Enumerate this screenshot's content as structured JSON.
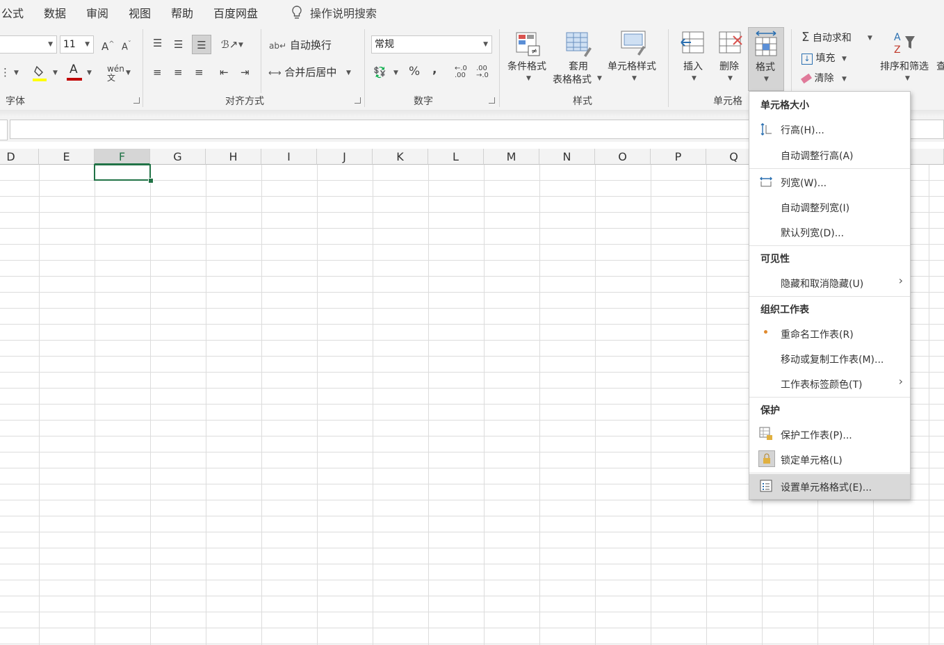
{
  "menu": {
    "tabs": [
      "公式",
      "数据",
      "审阅",
      "视图",
      "帮助",
      "百度网盘"
    ],
    "tellme": "操作说明搜索"
  },
  "ribbon": {
    "font": {
      "size": "11",
      "label": "字体"
    },
    "alignment": {
      "wrap_text": "自动换行",
      "merge_center": "合并后居中",
      "label": "对齐方式"
    },
    "number": {
      "format": "常规",
      "percent": "%",
      "comma": ",",
      "label": "数字"
    },
    "styles": {
      "conditional": "条件格式",
      "table_format_1": "套用",
      "table_format_2": "表格格式",
      "cell_styles": "单元格样式",
      "label": "样式"
    },
    "cells": {
      "insert": "插入",
      "delete": "删除",
      "format": "格式",
      "label": "单元格"
    },
    "editing": {
      "autosum": "自动求和",
      "fill": "填充",
      "clear": "清除",
      "sort_filter": "排序和筛选",
      "find": "查"
    }
  },
  "grid": {
    "columns": [
      "D",
      "E",
      "F",
      "G",
      "H",
      "I",
      "J",
      "K",
      "L",
      "M",
      "N",
      "O",
      "P",
      "Q"
    ],
    "selected_column": "F"
  },
  "dropdown": {
    "cell_size": "单元格大小",
    "row_height": "行高(H)...",
    "autofit_row": "自动调整行高(A)",
    "col_width": "列宽(W)...",
    "autofit_col": "自动调整列宽(I)",
    "default_width": "默认列宽(D)...",
    "visibility": "可见性",
    "hide_unhide": "隐藏和取消隐藏(U)",
    "organize": "组织工作表",
    "rename": "重命名工作表(R)",
    "move_copy": "移动或复制工作表(M)...",
    "tab_color": "工作表标签颜色(T)",
    "protection": "保护",
    "protect_sheet": "保护工作表(P)...",
    "lock_cell": "锁定单元格(L)",
    "format_cells": "设置单元格格式(E)..."
  },
  "colors": {
    "accent_green": "#217346",
    "font_color_red": "#c00000",
    "highlight_yellow": "#ffff00"
  }
}
